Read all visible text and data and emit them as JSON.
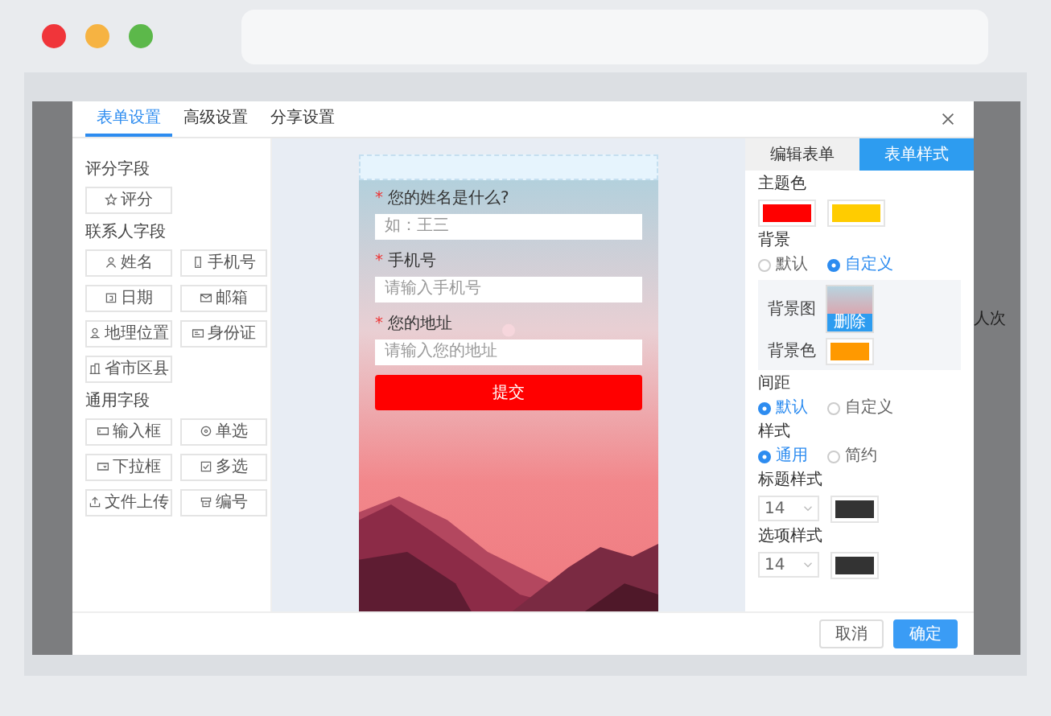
{
  "modal": {
    "tabs": [
      {
        "label": "表单设置",
        "selected": true
      },
      {
        "label": "高级设置",
        "selected": false
      },
      {
        "label": "分享设置",
        "selected": false
      }
    ]
  },
  "field_groups": [
    {
      "title": "评分字段",
      "fields": [
        {
          "label": "评分",
          "kind": "star"
        }
      ]
    },
    {
      "title": "联系人字段",
      "fields": [
        {
          "label": "姓名",
          "kind": "person"
        },
        {
          "label": "手机号",
          "kind": "phone"
        },
        {
          "label": "日期",
          "kind": "calendar"
        },
        {
          "label": "邮箱",
          "kind": "envelope"
        },
        {
          "label": "地理位置",
          "kind": "pin"
        },
        {
          "label": "身份证",
          "kind": "card"
        },
        {
          "label": "省市区县",
          "kind": "building"
        }
      ]
    },
    {
      "title": "通用字段",
      "fields": [
        {
          "label": "输入框",
          "kind": "input"
        },
        {
          "label": "单选",
          "kind": "radio"
        },
        {
          "label": "下拉框",
          "kind": "dropdown"
        },
        {
          "label": "多选",
          "kind": "checkbox"
        },
        {
          "label": "文件上传",
          "kind": "upload"
        },
        {
          "label": "编号",
          "kind": "tray"
        }
      ]
    }
  ],
  "preview": {
    "questions": [
      {
        "required_mark": "*",
        "label": "您的姓名是什么?",
        "placeholder": "如：王三"
      },
      {
        "required_mark": "*",
        "label": "手机号",
        "placeholder": "请输入手机号"
      },
      {
        "required_mark": "*",
        "label": "您的地址",
        "placeholder": "请输入您的地址"
      }
    ],
    "submit": "提交"
  },
  "style_panel": {
    "tabs": [
      {
        "label": "编辑表单",
        "selected": false
      },
      {
        "label": "表单样式",
        "selected": true
      }
    ],
    "theme": {
      "label": "主题色",
      "swatches": [
        {
          "color": "#ff0000"
        },
        {
          "color": "#ffcc00"
        }
      ]
    },
    "background": {
      "label": "背景",
      "options": [
        {
          "label": "默认",
          "selected": false
        },
        {
          "label": "自定义",
          "selected": true
        }
      ],
      "image_label": "背景图",
      "delete": "删除",
      "color_label": "背景色",
      "color": "#ff9900"
    },
    "spacing": {
      "label": "间距",
      "options": [
        {
          "label": "默认",
          "selected": true
        },
        {
          "label": "自定义",
          "selected": false
        }
      ]
    },
    "style": {
      "label": "样式",
      "options": [
        {
          "label": "通用",
          "selected": true
        },
        {
          "label": "简约",
          "selected": false
        }
      ]
    },
    "text_styles": [
      {
        "label": "标题样式",
        "size": "14",
        "color": "#333333"
      },
      {
        "label": "选项样式",
        "size": "14",
        "color": "#333333"
      }
    ]
  },
  "footer": {
    "buttons": [
      {
        "label": "取消",
        "primary": false
      },
      {
        "label": "确定",
        "primary": true
      }
    ]
  },
  "backdrop_text": "人次"
}
